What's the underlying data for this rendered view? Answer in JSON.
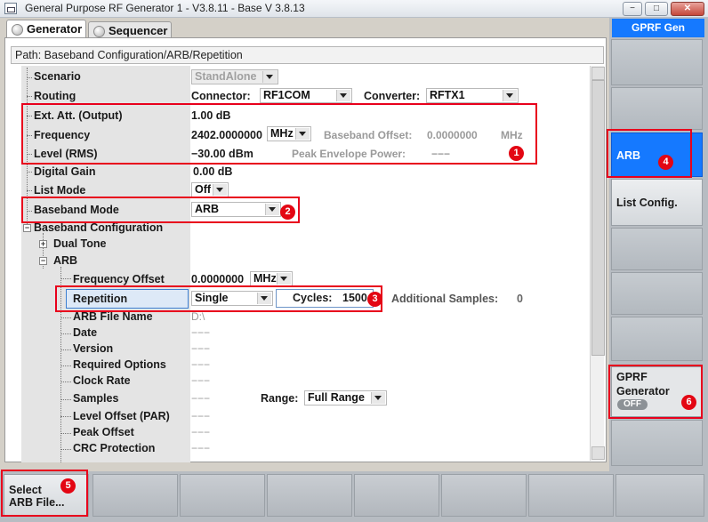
{
  "window": {
    "title": "General Purpose RF Generator 1 - V3.8.11 - Base V 3.8.13",
    "btn_min": "−",
    "btn_max": "□",
    "btn_close": "✕"
  },
  "tabs": [
    {
      "label": "Generator"
    },
    {
      "label": "Sequencer"
    }
  ],
  "path": {
    "label": "Path:",
    "value": "Baseband Configuration/ARB/Repetition"
  },
  "rows": {
    "scenario": {
      "label": "Scenario",
      "value": "StandAlone"
    },
    "routing": {
      "label": "Routing",
      "connector_label": "Connector:",
      "connector_value": "RF1COM",
      "converter_label": "Converter:",
      "converter_value": "RFTX1"
    },
    "ext_att": {
      "label": "Ext. Att. (Output)",
      "value": "1.00 dB"
    },
    "frequency": {
      "label": "Frequency",
      "value": "2402.0000000",
      "unit": "MHz",
      "bb_offset_label": "Baseband Offset:",
      "bb_offset_value": "0.0000000",
      "bb_offset_unit": "MHz"
    },
    "level": {
      "label": "Level (RMS)",
      "value": "−30.00 dBm",
      "pep_label": "Peak Envelope Power:",
      "pep_value": "−−−"
    },
    "digital_gain": {
      "label": "Digital Gain",
      "value": "0.00 dB"
    },
    "list_mode": {
      "label": "List Mode",
      "value": "Off"
    },
    "baseband_mode": {
      "label": "Baseband Mode",
      "value": "ARB"
    },
    "baseband_config": {
      "label": "Baseband Configuration"
    },
    "dual_tone": {
      "label": "Dual Tone"
    },
    "arb": {
      "label": "ARB"
    },
    "freq_offset": {
      "label": "Frequency Offset",
      "value": "0.0000000",
      "unit": "MHz"
    },
    "repetition": {
      "label": "Repetition",
      "value": "Single",
      "cycles_label": "Cycles:",
      "cycles_value": "1500",
      "add_samples_label": "Additional Samples:",
      "add_samples_value": "0"
    },
    "arb_file_name": {
      "label": "ARB File Name",
      "value": "D:\\"
    },
    "date": {
      "label": "Date",
      "value": "−−−"
    },
    "version": {
      "label": "Version",
      "value": "−−−"
    },
    "required_options": {
      "label": "Required Options",
      "value": "−−−"
    },
    "clock_rate": {
      "label": "Clock Rate",
      "value": "−−−"
    },
    "samples": {
      "label": "Samples",
      "value": "−−−",
      "range_label": "Range:",
      "range_value": "Full Range"
    },
    "level_offset": {
      "label": "Level Offset (PAR)",
      "value": "−−−"
    },
    "peak_offset": {
      "label": "Peak Offset",
      "value": "−−−"
    },
    "crc_protection": {
      "label": "CRC Protection",
      "value": "−−−"
    }
  },
  "right_panel": {
    "header": "GPRF Gen",
    "arb_button": "ARB",
    "list_config_button": "List Config.",
    "gprf_generator_label_1": "GPRF",
    "gprf_generator_label_2": "Generator",
    "gprf_state": "OFF"
  },
  "bottom": {
    "select_arb_line1": "Select",
    "select_arb_line2": "ARB File..."
  },
  "annotations": {
    "b1": "1",
    "b2": "2",
    "b3": "3",
    "b4": "4",
    "b5": "5",
    "b6": "6"
  },
  "colors": {
    "highlight_blue": "#1579ff",
    "annotation_red": "#e8001c"
  }
}
